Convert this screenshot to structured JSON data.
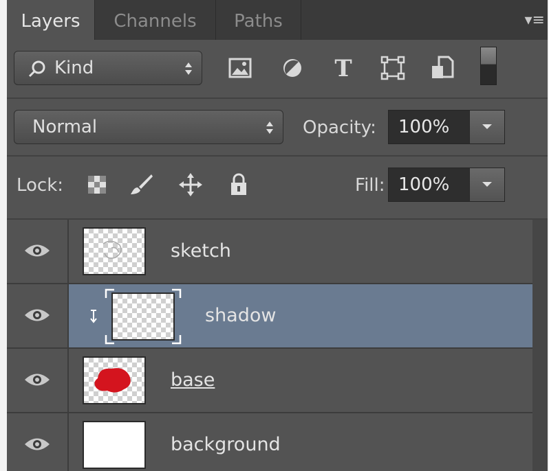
{
  "tabs": {
    "layers": "Layers",
    "channels": "Channels",
    "paths": "Paths"
  },
  "filter": {
    "kind_label": "Kind"
  },
  "blend": {
    "mode": "Normal",
    "opacity_label": "Opacity:",
    "opacity_value": "100%"
  },
  "lock": {
    "label": "Lock:",
    "fill_label": "Fill:",
    "fill_value": "100%"
  },
  "layers": [
    {
      "name": "sketch",
      "selected": false,
      "clipped": false,
      "thumb": "checker"
    },
    {
      "name": "shadow",
      "selected": true,
      "clipped": true,
      "thumb": "checker"
    },
    {
      "name": "base",
      "selected": false,
      "clipped": false,
      "thumb": "checker-red"
    },
    {
      "name": "background",
      "selected": false,
      "clipped": false,
      "thumb": "white"
    }
  ],
  "colors": {
    "panel_bg": "#535353",
    "selected_row": "#6a7b91",
    "base_paint": "#d4141e"
  }
}
